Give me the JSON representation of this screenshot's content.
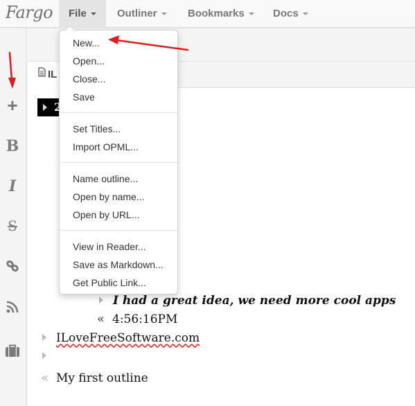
{
  "app": {
    "brand": "Fargo"
  },
  "navbar": {
    "items": [
      {
        "label": "File",
        "active": true
      },
      {
        "label": "Outliner",
        "active": false
      },
      {
        "label": "Bookmarks",
        "active": false
      },
      {
        "label": "Docs",
        "active": false
      }
    ]
  },
  "toolbar": {
    "icons": [
      "plus-icon",
      "bold-icon",
      "italic-icon",
      "strikethrough-icon",
      "link-icon",
      "rss-icon",
      "briefcase-icon"
    ],
    "bold_glyph": "B",
    "italic_glyph": "I",
    "strike_glyph": "S",
    "plus_glyph": "+"
  },
  "tab": {
    "label": "IL"
  },
  "file_menu": {
    "groups": [
      [
        "New...",
        "Open...",
        "Close...",
        "Save"
      ],
      [
        "Set Titles...",
        "Import OPML..."
      ],
      [
        "Name outline...",
        "Open by name...",
        "Open by URL..."
      ],
      [
        "View in Reader...",
        "Save as Markdown...",
        "Get Public Link..."
      ]
    ]
  },
  "outline": {
    "selected_row_text": "2",
    "rows": [
      {
        "text": "I had a great idea, we need more cool apps",
        "style": "bold-italic",
        "marker": "wedge",
        "level": 2
      },
      {
        "text": "4:56:16PM",
        "style": "normal",
        "marker": "double-quote",
        "level": 2
      },
      {
        "text": "ILoveFreeSoftware.com",
        "style": "normal",
        "marker": "wedge",
        "level": 0,
        "spellcheck_underline": true
      },
      {
        "text": "",
        "style": "normal",
        "marker": "wedge",
        "level": 0
      },
      {
        "text": "My first outline",
        "style": "normal",
        "marker": "double-quote",
        "level": 0
      }
    ],
    "double_quote_glyph": "«"
  },
  "colors": {
    "annotation_arrow": "#e01b1b",
    "selection": "#000000",
    "spellcheck": "#dd3333"
  }
}
